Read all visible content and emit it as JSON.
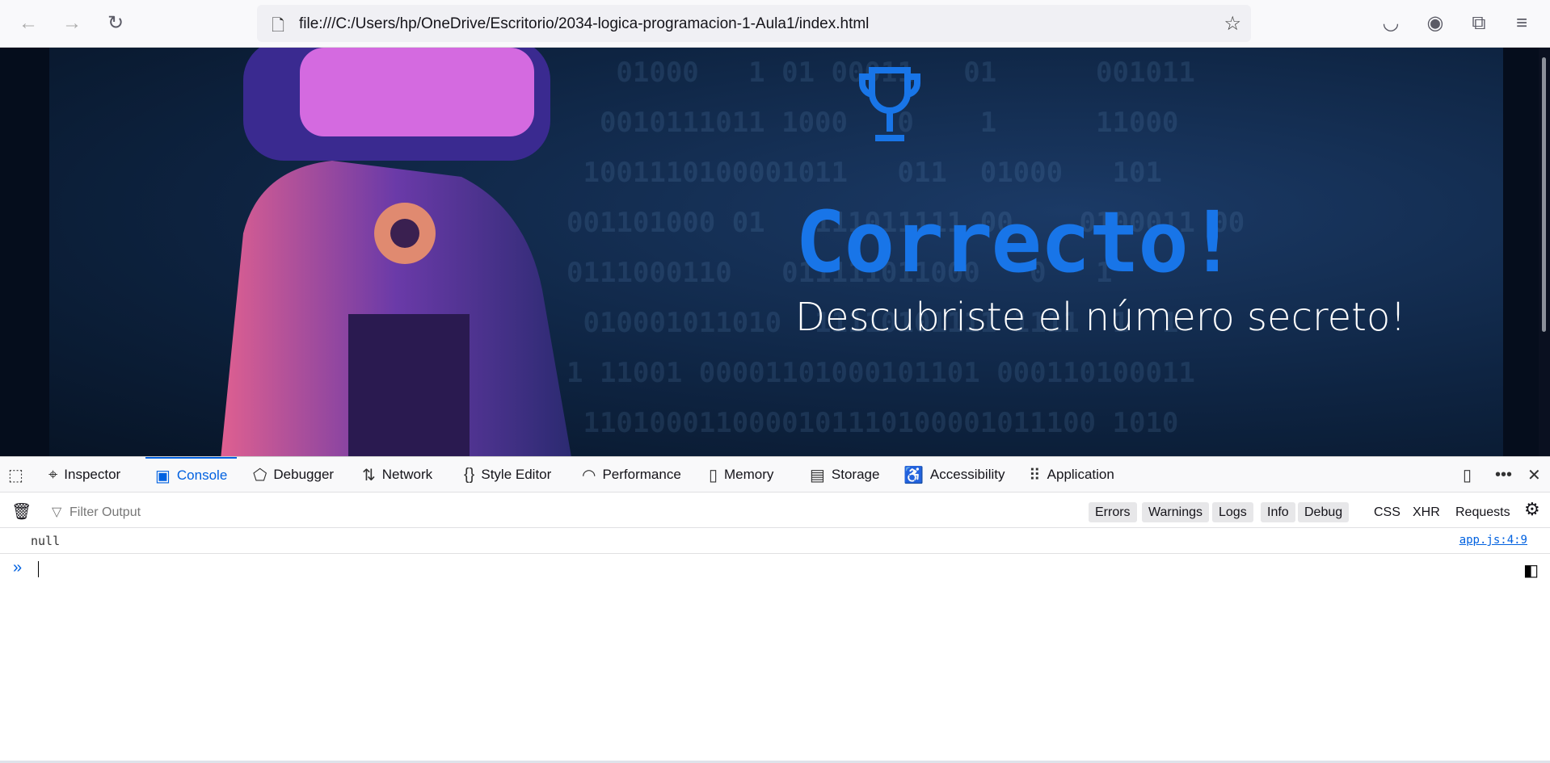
{
  "browser": {
    "url": "file:///C:/Users/hp/OneDrive/Escritorio/2034-logica-programacion-1-Aula1/index.html"
  },
  "page": {
    "title": "Correcto!",
    "subtitle": "Descubriste el número secreto!",
    "accent": "#1875e8"
  },
  "devtools": {
    "tabs": [
      {
        "label": "Inspector"
      },
      {
        "label": "Console"
      },
      {
        "label": "Debugger"
      },
      {
        "label": "Network"
      },
      {
        "label": "Style Editor"
      },
      {
        "label": "Performance"
      },
      {
        "label": "Memory"
      },
      {
        "label": "Storage"
      },
      {
        "label": "Accessibility"
      },
      {
        "label": "Application"
      }
    ],
    "active_tab": "Console",
    "filter_placeholder": "Filter Output",
    "levels": [
      "Errors",
      "Warnings",
      "Logs",
      "Info",
      "Debug"
    ],
    "types": [
      "CSS",
      "XHR",
      "Requests"
    ],
    "messages": [
      {
        "text": "null",
        "source": "app.js:4:9"
      }
    ],
    "prompt": "»"
  }
}
